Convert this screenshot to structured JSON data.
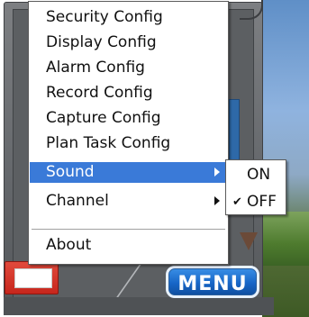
{
  "menu": {
    "items": [
      {
        "label": "Security Config"
      },
      {
        "label": "Display Config"
      },
      {
        "label": "Alarm Config"
      },
      {
        "label": "Record Config"
      },
      {
        "label": "Capture Config"
      },
      {
        "label": "Plan Task Config"
      },
      {
        "label": "Sound",
        "selected": true,
        "has_submenu": true
      },
      {
        "label": "Channel",
        "has_submenu": true
      },
      {
        "label": "About"
      }
    ]
  },
  "submenu": {
    "items": [
      {
        "label": "ON",
        "checked": false
      },
      {
        "label": "OFF",
        "checked": true
      }
    ],
    "check_glyph": "✔"
  },
  "menu_button": {
    "label": "MENU"
  },
  "colors": {
    "highlight": "#3a7ad8",
    "menu_button": "#1766c7"
  }
}
